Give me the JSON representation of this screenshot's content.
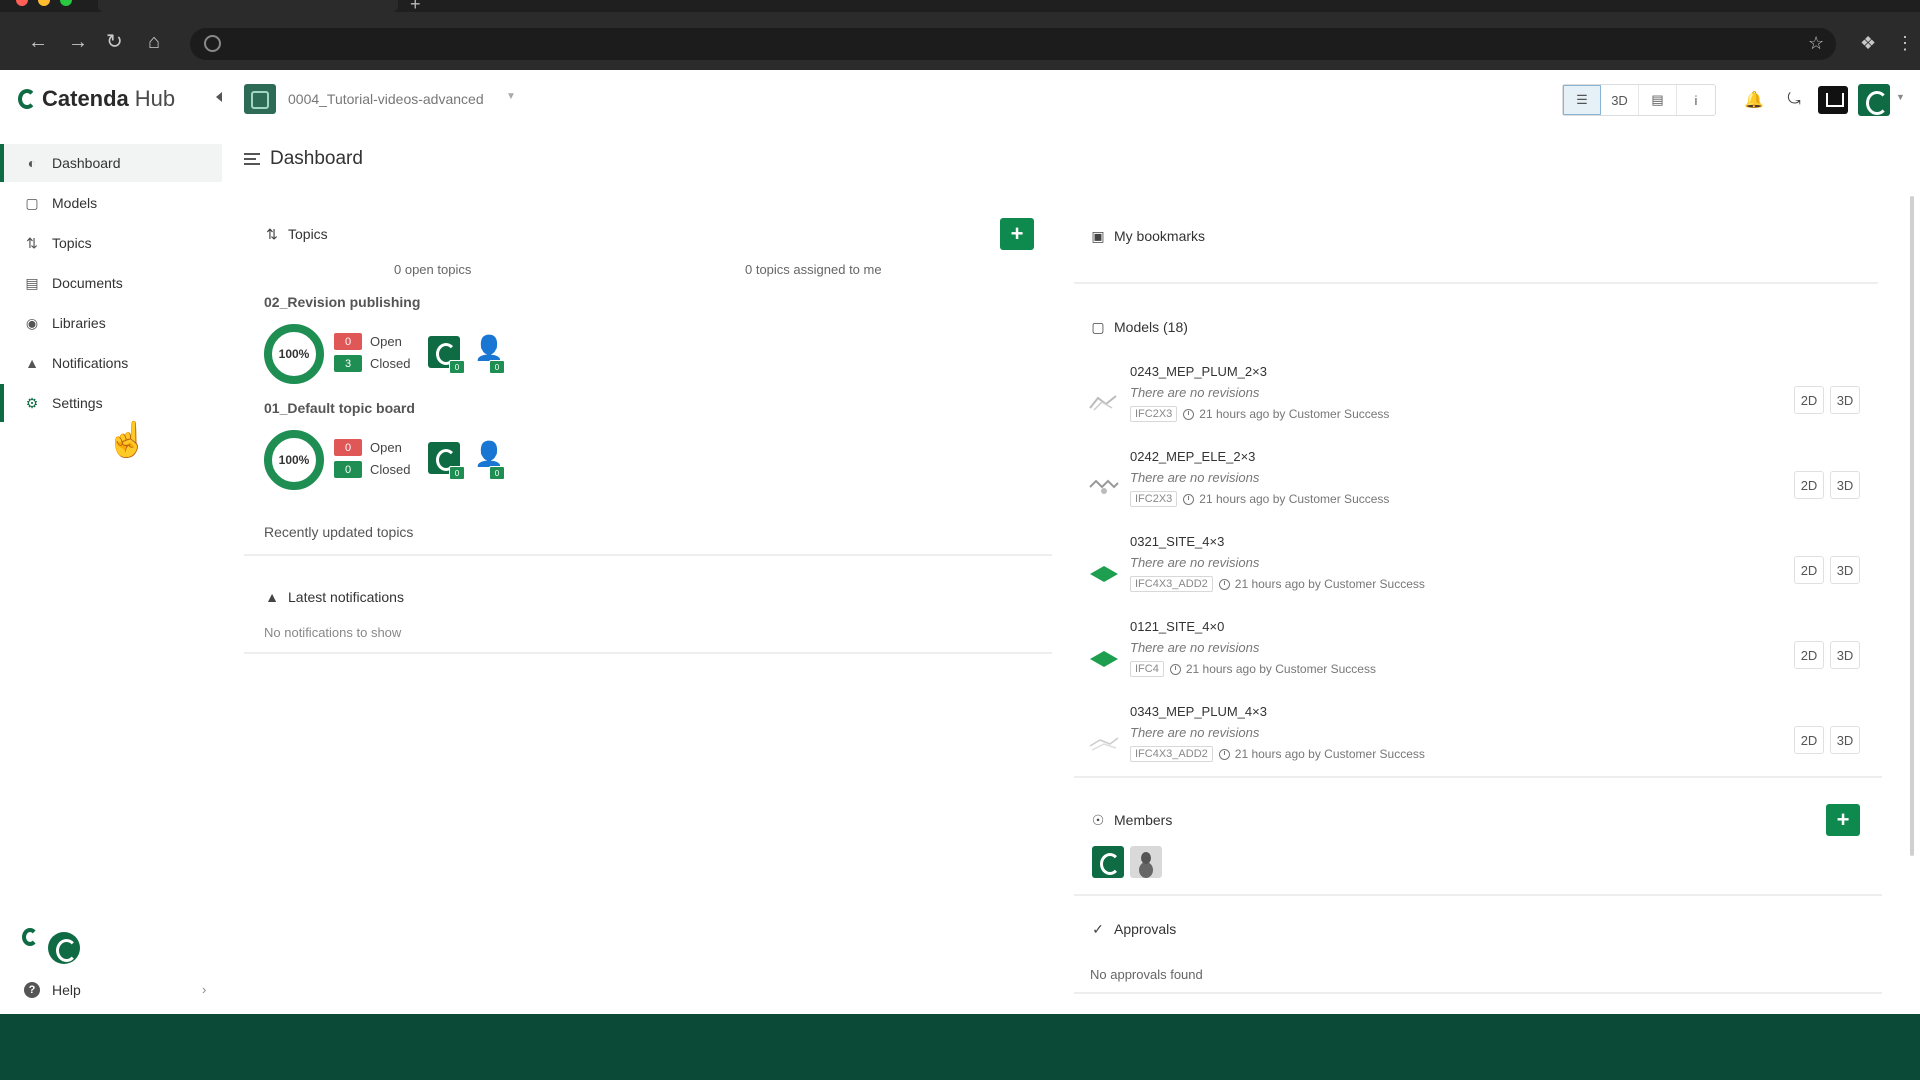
{
  "app": {
    "logo_name": "Catenda",
    "logo_suffix": "Hub",
    "project_name": "0004_Tutorial-videos-advanced"
  },
  "header": {
    "view_3d_label": "3D",
    "info_label": "i"
  },
  "sidebar": {
    "items": [
      {
        "label": "Dashboard",
        "icon": "dashboard-icon",
        "active": true
      },
      {
        "label": "Models",
        "icon": "cube-icon"
      },
      {
        "label": "Topics",
        "icon": "topics-icon"
      },
      {
        "label": "Documents",
        "icon": "folder-icon"
      },
      {
        "label": "Libraries",
        "icon": "library-icon"
      },
      {
        "label": "Notifications",
        "icon": "bell-icon"
      },
      {
        "label": "Settings",
        "icon": "gear-icon"
      }
    ],
    "help_label": "Help"
  },
  "dashboard": {
    "title": "Dashboard",
    "topics": {
      "title": "Topics",
      "open_topics": "0 open topics",
      "assigned": "0 topics assigned to me",
      "boards": [
        {
          "name": "02_Revision publishing",
          "percent": "100%",
          "open_count": "0",
          "closed_count": "3",
          "open_label": "Open",
          "closed_label": "Closed",
          "member_badge": "0",
          "unassigned_badge": "0"
        },
        {
          "name": "01_Default topic board",
          "percent": "100%",
          "open_count": "0",
          "closed_count": "0",
          "open_label": "Open",
          "closed_label": "Closed",
          "member_badge": "0",
          "unassigned_badge": "0"
        }
      ],
      "recent_label": "Recently updated topics"
    },
    "notifications": {
      "title": "Latest notifications",
      "empty": "No notifications to show"
    },
    "bookmarks": {
      "title": "My bookmarks"
    },
    "models": {
      "title": "Models (18)",
      "view_2d": "2D",
      "view_3d": "3D",
      "items": [
        {
          "name": "0243_MEP_PLUM_2×3",
          "revisions": "There are no revisions",
          "schema": "IFC2X3",
          "time": "21 hours ago",
          "by": "by Customer Success"
        },
        {
          "name": "0242_MEP_ELE_2×3",
          "revisions": "There are no revisions",
          "schema": "IFC2X3",
          "time": "21 hours ago",
          "by": "by Customer Success"
        },
        {
          "name": "0321_SITE_4×3",
          "revisions": "There are no revisions",
          "schema": "IFC4X3_ADD2",
          "time": "21 hours ago",
          "by": "by Customer Success"
        },
        {
          "name": "0121_SITE_4×0",
          "revisions": "There are no revisions",
          "schema": "IFC4",
          "time": "21 hours ago",
          "by": "by Customer Success"
        },
        {
          "name": "0343_MEP_PLUM_4×3",
          "revisions": "There are no revisions",
          "schema": "IFC4X3_ADD2",
          "time": "21 hours ago",
          "by": "by Customer Success"
        }
      ]
    },
    "members": {
      "title": "Members"
    },
    "approvals": {
      "title": "Approvals",
      "empty": "No approvals found"
    }
  },
  "colors": {
    "brand": "#0f6b44",
    "accent_button": "#0f8a4f",
    "open_badge": "#e05757",
    "closed_badge": "#1e8e53",
    "footer_band": "#0b4a37"
  }
}
